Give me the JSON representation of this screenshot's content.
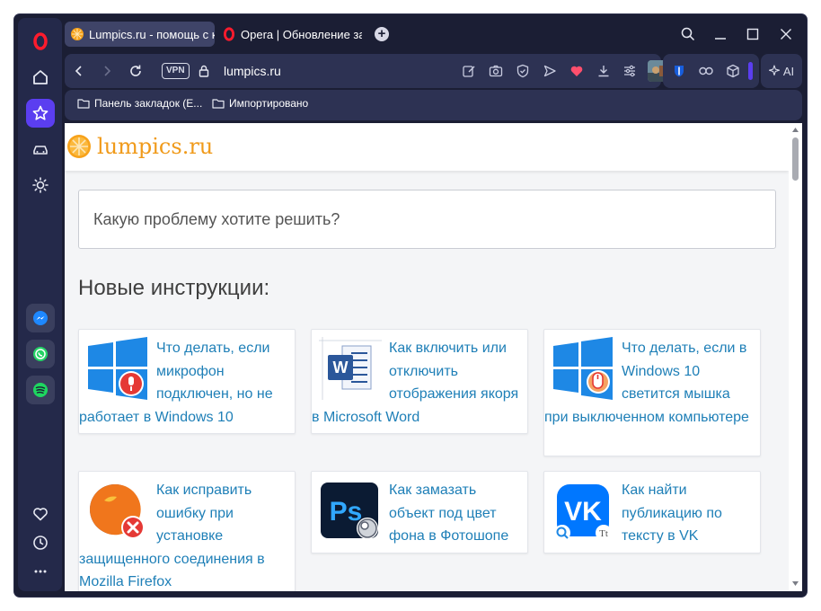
{
  "browser": {
    "tabs": [
      {
        "title": "Lumpics.ru - помощь с компьютером",
        "favicon": "orange-icon",
        "active": true
      },
      {
        "title": "Opera | Обновление завершено",
        "favicon": "opera-icon",
        "active": false
      }
    ],
    "new_tab_label": "+",
    "address": {
      "vpn_label": "VPN",
      "url": "lumpics.ru"
    },
    "ai_label": "AI",
    "bookmarks": [
      {
        "label": "Панель закладок (E...",
        "icon": "folder-icon"
      },
      {
        "label": "Импортировано",
        "icon": "folder-icon"
      }
    ],
    "accent_color": "#5b3ef0",
    "sidebar_icons": [
      "opera-logo-icon",
      "home-icon",
      "star-icon",
      "car-icon",
      "sun-icon",
      "messenger-icon",
      "whatsapp-icon",
      "spotify-icon",
      "heart-icon",
      "history-icon",
      "more-icon"
    ]
  },
  "site": {
    "logo_text": "lumpics.ru",
    "search_placeholder": "Какую проблему хотите решить?",
    "section_title": "Новые инструкции:",
    "link_color": "#1e7fb7",
    "cards": [
      {
        "title": "Что делать, если микрофон подключен, но не работает в Windows 10",
        "icon": "windows-mic-icon"
      },
      {
        "title": "Как включить или отключить отображения якоря в Microsoft Word",
        "icon": "word-icon"
      },
      {
        "title": "Что делать, если в Windows 10 светится мышка при выключенном компьютере",
        "icon": "windows-mouse-icon"
      },
      {
        "title": "Как исправить ошибку при установке защищенного соединения в Mozilla Firefox",
        "icon": "firefox-error-icon"
      },
      {
        "title": "Как замазать объект под цвет фона в Фотошопе",
        "icon": "photoshop-icon"
      },
      {
        "title": "Как найти публикацию по тексту в VK",
        "icon": "vk-icon"
      }
    ]
  }
}
